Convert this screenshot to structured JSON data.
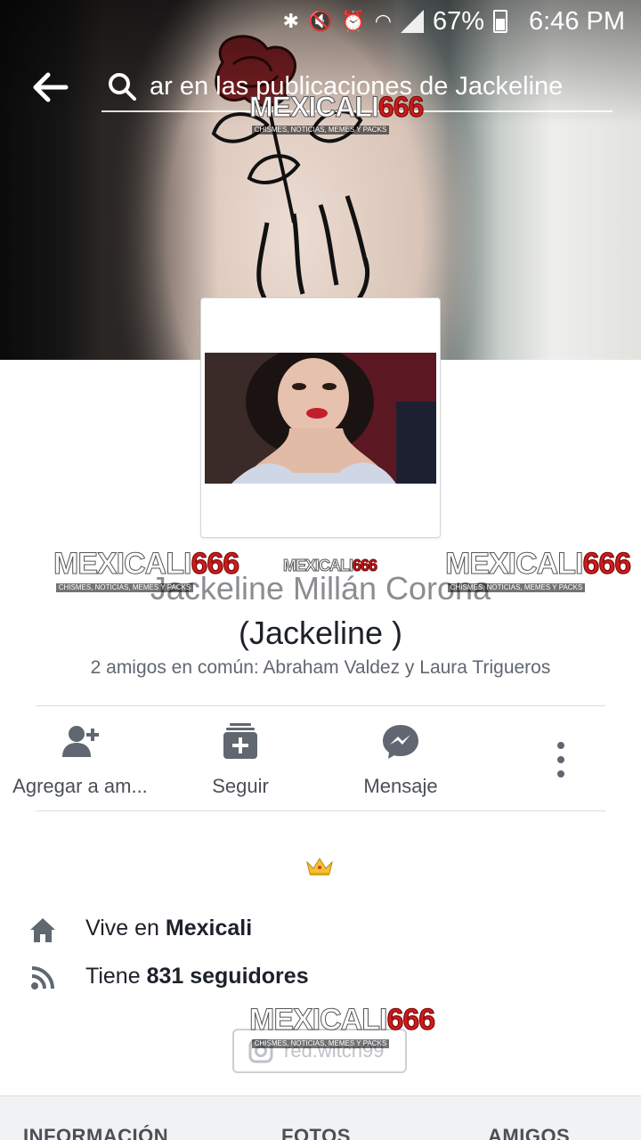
{
  "status_bar": {
    "battery": "67%",
    "time": "6:46 PM",
    "icons": [
      "bluetooth-icon",
      "mute-icon",
      "alarm-icon",
      "wifi-icon",
      "signal-icon",
      "battery-icon"
    ]
  },
  "search": {
    "text": "ar en las publicaciones de Jackeline"
  },
  "watermark": {
    "brand": "MEXICALI",
    "number": "666",
    "tagline": "CHISMES, NOTICIAS, MEMES Y PACKS"
  },
  "profile": {
    "name_line1": "Jackeline Millán Corona",
    "name_line2": "(Jackeline )",
    "mutual_friends": "2 amigos en común: Abraham Valdez y Laura Trigueros"
  },
  "actions": {
    "add_friend": "Agregar a am...",
    "follow": "Seguir",
    "message": "Mensaje"
  },
  "bio_emoji": "👑",
  "info": {
    "lives_prefix": "Vive en ",
    "lives_city": "Mexicali",
    "followers_prefix": "Tiene ",
    "followers_count": "831 seguidores"
  },
  "instagram": {
    "handle": "red.witch99"
  },
  "tabs": {
    "info": "INFORMACIÓN",
    "photos": "FOTOS",
    "friends": "AMIGOS"
  },
  "colors": {
    "icon_gray": "#606770",
    "text_dark": "#1d2129",
    "brand_red": "#d11a1a"
  }
}
